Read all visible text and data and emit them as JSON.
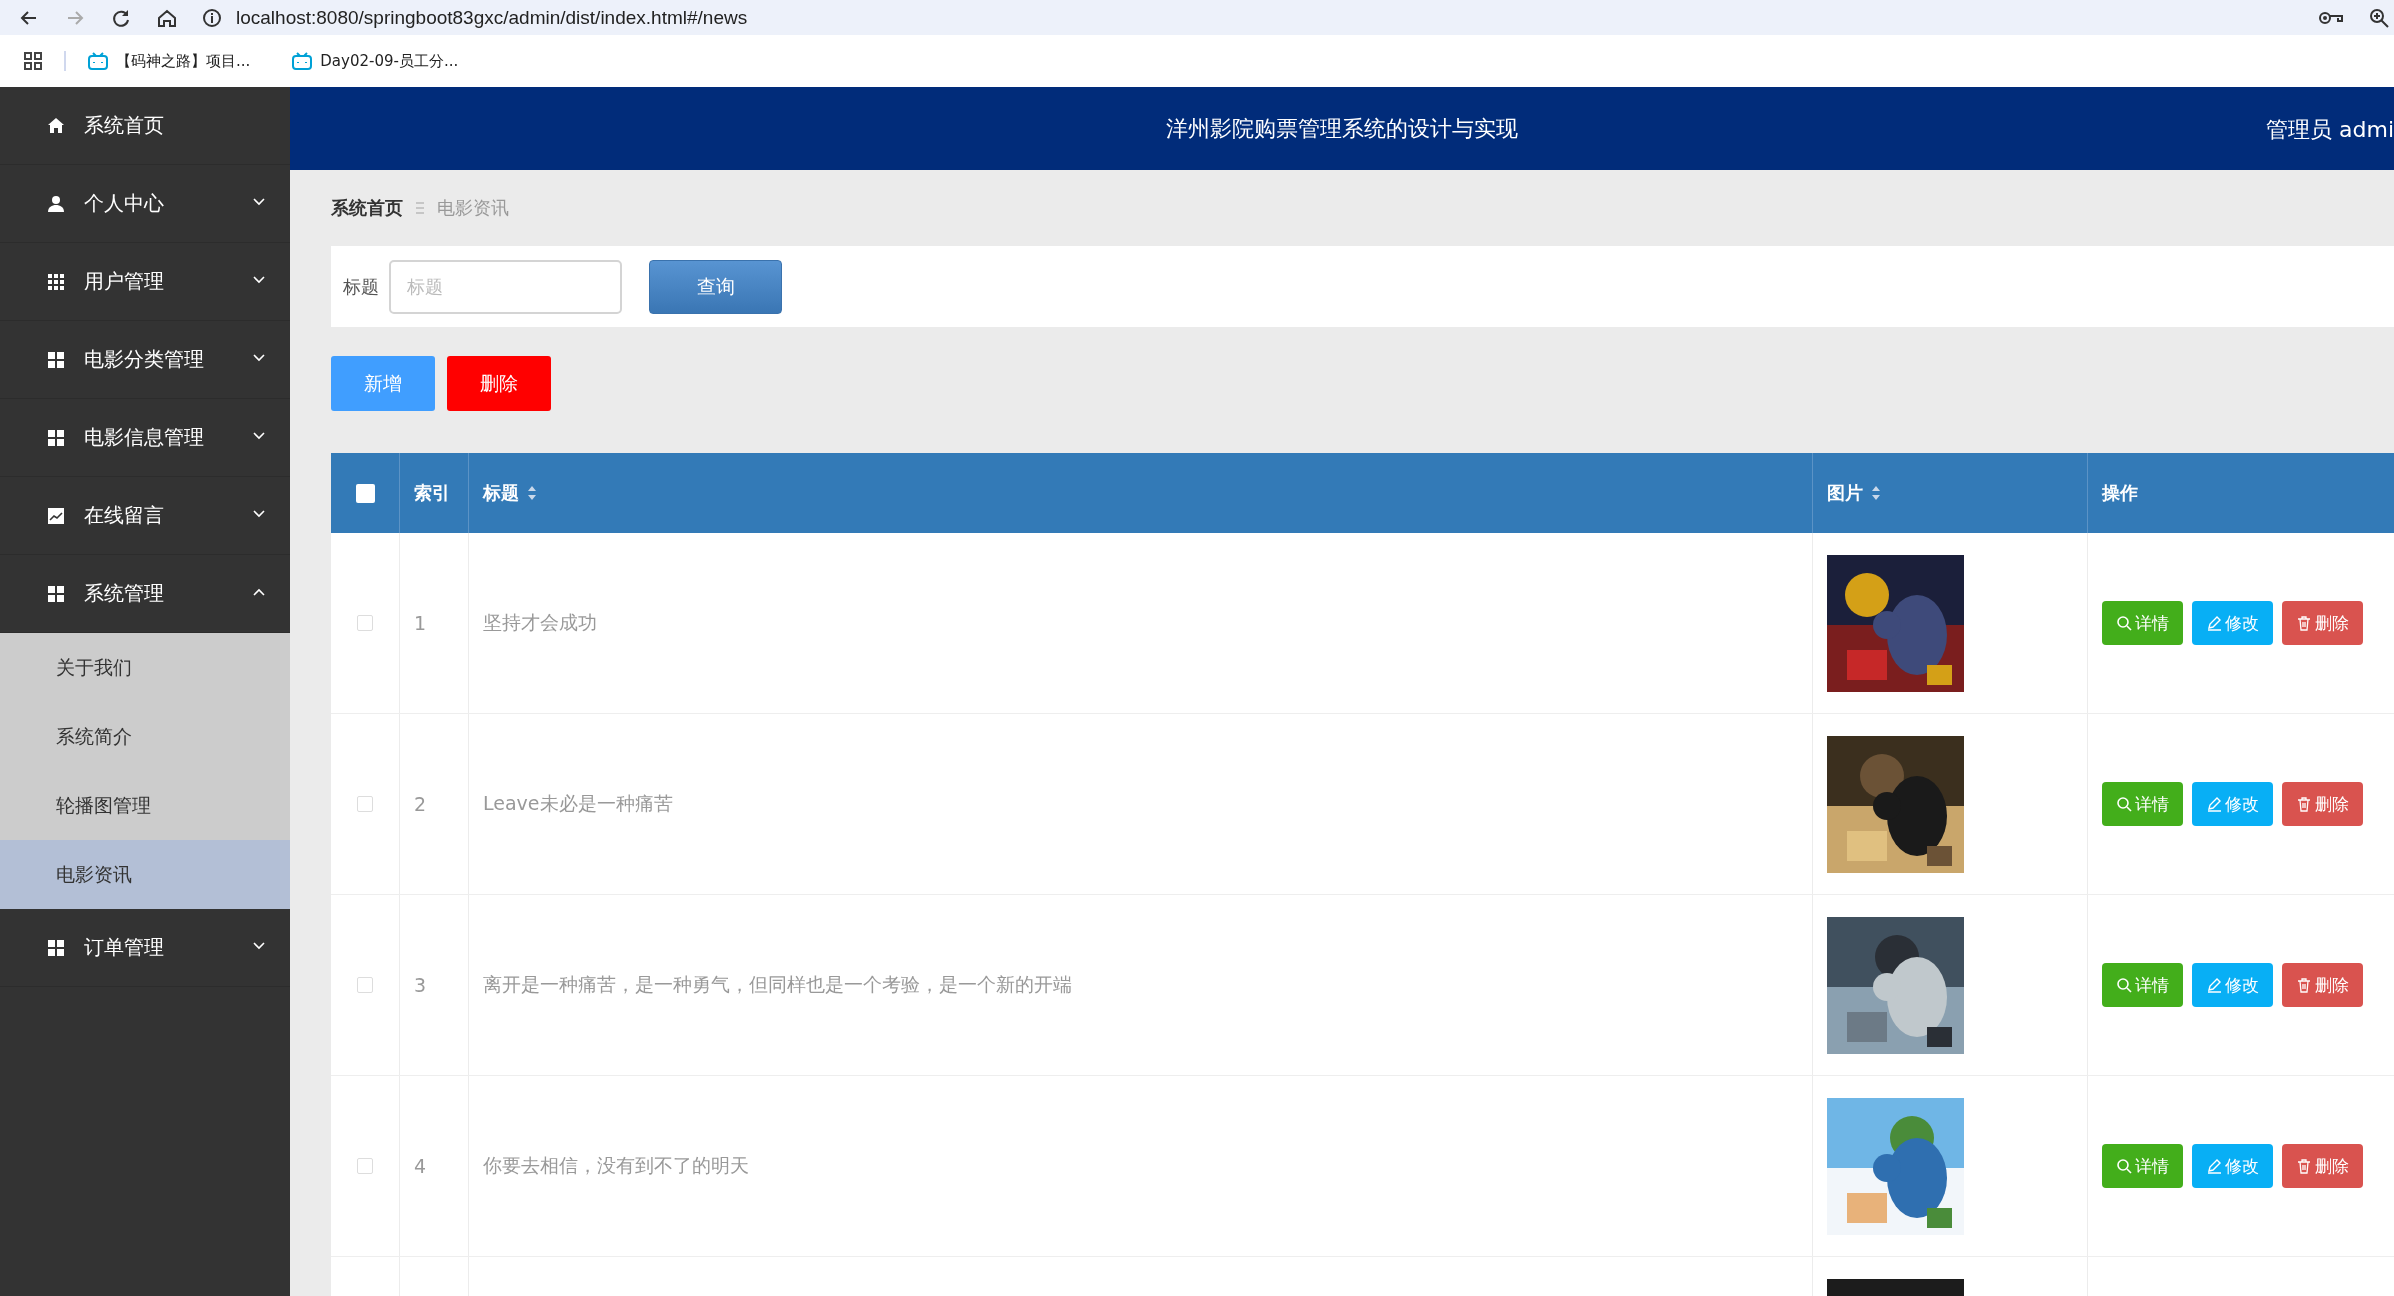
{
  "browser": {
    "url": "localhost:8080/springboot83gxc/admin/dist/index.html#/news",
    "bookmarks": [
      {
        "label": "【码神之路】项目..."
      },
      {
        "label": "Day02-09-员工分..."
      }
    ]
  },
  "sidebar": {
    "items": [
      {
        "label": "系统首页",
        "kind": "home"
      },
      {
        "label": "个人中心",
        "kind": "person",
        "expanded": false
      },
      {
        "label": "用户管理",
        "kind": "grid",
        "expanded": false
      },
      {
        "label": "电影分类管理",
        "kind": "tiles",
        "expanded": false
      },
      {
        "label": "电影信息管理",
        "kind": "tiles",
        "expanded": false
      },
      {
        "label": "在线留言",
        "kind": "chart",
        "expanded": false
      },
      {
        "label": "系统管理",
        "kind": "tiles",
        "expanded": true,
        "children": [
          {
            "label": "关于我们",
            "selected": false
          },
          {
            "label": "系统简介",
            "selected": false
          },
          {
            "label": "轮播图管理",
            "selected": false
          },
          {
            "label": "电影资讯",
            "selected": true
          }
        ]
      },
      {
        "label": "订单管理",
        "kind": "tiles",
        "expanded": false
      }
    ]
  },
  "header": {
    "title": "洋州影院购票管理系统的设计与实现",
    "user": "管理员 admi"
  },
  "breadcrumb": [
    "系统首页",
    "电影资讯"
  ],
  "search": {
    "label": "标题",
    "placeholder": "标题",
    "button": "查询"
  },
  "actions": [
    {
      "label": "新增",
      "kind": "add"
    },
    {
      "label": "删除",
      "kind": "delete"
    }
  ],
  "table": {
    "select_all": {
      "checked": false
    },
    "columns": [
      {
        "label": "索引",
        "sortable": false
      },
      {
        "label": "标题",
        "sortable": true
      },
      {
        "label": "图片",
        "sortable": true
      },
      {
        "label": "操作",
        "sortable": false
      }
    ],
    "rows": [
      {
        "checked": false,
        "index": "1",
        "title": "坚持才会成功",
        "picture": {
          "kind": "picture"
        },
        "buttons": [
          {
            "label": "详情",
            "kind": "detail"
          },
          {
            "label": "修改",
            "kind": "edit"
          },
          {
            "label": "删除",
            "kind": "delete"
          }
        ]
      },
      {
        "checked": false,
        "index": "2",
        "title": "Leave未必是一种痛苦",
        "picture": {
          "kind": "picture"
        },
        "buttons": [
          {
            "label": "详情",
            "kind": "detail"
          },
          {
            "label": "修改",
            "kind": "edit"
          },
          {
            "label": "删除",
            "kind": "delete"
          }
        ]
      },
      {
        "checked": false,
        "index": "3",
        "title": "离开是一种痛苦，是一种勇气，但同样也是一个考验，是一个新的开端",
        "picture": {
          "kind": "picture"
        },
        "buttons": [
          {
            "label": "详情",
            "kind": "detail"
          },
          {
            "label": "修改",
            "kind": "edit"
          },
          {
            "label": "删除",
            "kind": "delete"
          }
        ]
      },
      {
        "checked": false,
        "index": "4",
        "title": "你要去相信，没有到不了的明天",
        "picture": {
          "kind": "picture"
        },
        "buttons": [
          {
            "label": "详情",
            "kind": "detail"
          },
          {
            "label": "修改",
            "kind": "edit"
          },
          {
            "label": "删除",
            "kind": "delete"
          }
        ]
      },
      {
        "picture": {
          "kind": "picture"
        }
      }
    ]
  }
}
